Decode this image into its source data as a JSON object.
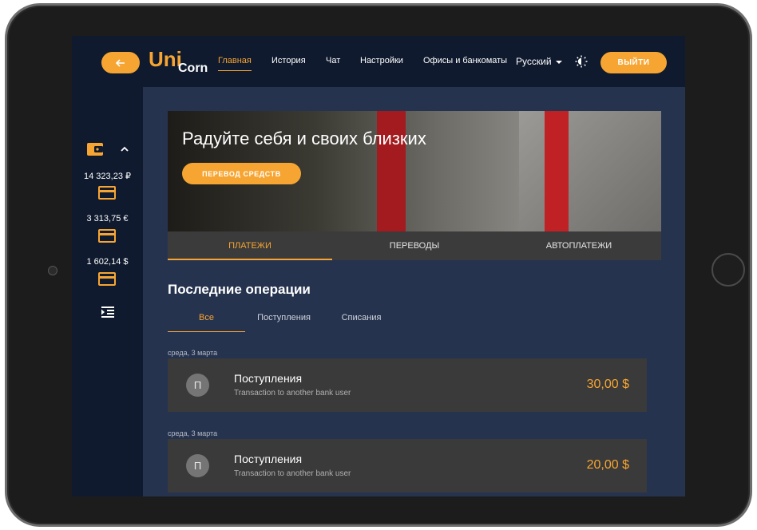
{
  "colors": {
    "accent": "#f7a532",
    "topbar": "#0f1a2e",
    "content": "#26334f",
    "card": "#3a3a3a"
  },
  "header": {
    "back_icon": "arrow-left-icon",
    "logo_primary": "Uni",
    "logo_secondary": "Corn",
    "nav": [
      {
        "label": "Главная",
        "active": true
      },
      {
        "label": "История"
      },
      {
        "label": "Чат"
      },
      {
        "label": "Настройки"
      },
      {
        "label": "Офисы и банкоматы"
      }
    ],
    "language": "Русский",
    "theme_icon": "brightness-icon",
    "logout_label": "ВЫЙТИ"
  },
  "sidebar": {
    "wallet_icon": "wallet-icon",
    "balances": [
      "14 323,23 ₽",
      "3 313,75 €",
      "1 602,14 $"
    ],
    "card_icon": "credit-card-icon",
    "collapse_icon": "menu-collapse-icon"
  },
  "banner": {
    "title": "Радуйте себя и своих близких",
    "button_label": "ПЕРЕВОД СРЕДСТВ"
  },
  "tabs": [
    {
      "label": "ПЛАТЕЖИ",
      "active": true
    },
    {
      "label": "ПЕРЕВОДЫ"
    },
    {
      "label": "АВТОПЛАТЕЖИ"
    }
  ],
  "operations": {
    "title": "Последние операции",
    "filters": [
      {
        "label": "Все",
        "active": true
      },
      {
        "label": "Поступления"
      },
      {
        "label": "Списания"
      }
    ],
    "items": [
      {
        "date": "среда, 3 марта",
        "avatar": "П",
        "title": "Поступления",
        "description": "Transaction to another bank user",
        "amount": "30,00 $"
      },
      {
        "date": "среда, 3 марта",
        "avatar": "П",
        "title": "Поступления",
        "description": "Transaction to another bank user",
        "amount": "20,00 $"
      }
    ]
  }
}
